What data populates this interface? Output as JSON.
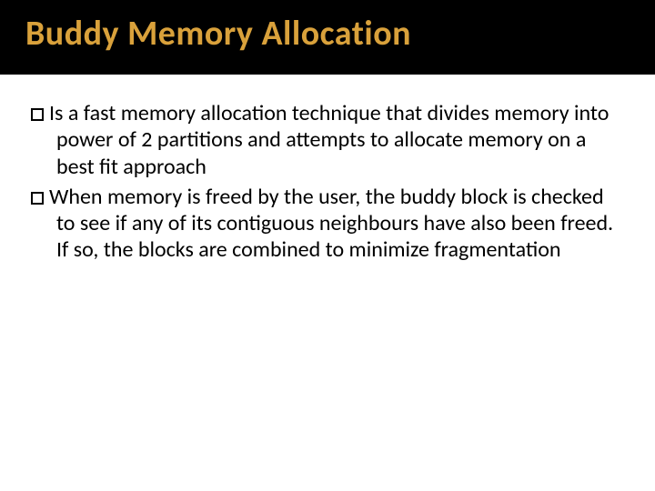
{
  "title": "Buddy Memory Allocation",
  "bullets": [
    "Is a fast memory allocation technique that divides memory into power of 2 partitions and attempts to allocate memory on a best fit approach",
    "When memory is freed by the user, the buddy block is checked to see if any of its contiguous neighbours have also been freed. If so, the blocks are combined to minimize fragmentation"
  ]
}
